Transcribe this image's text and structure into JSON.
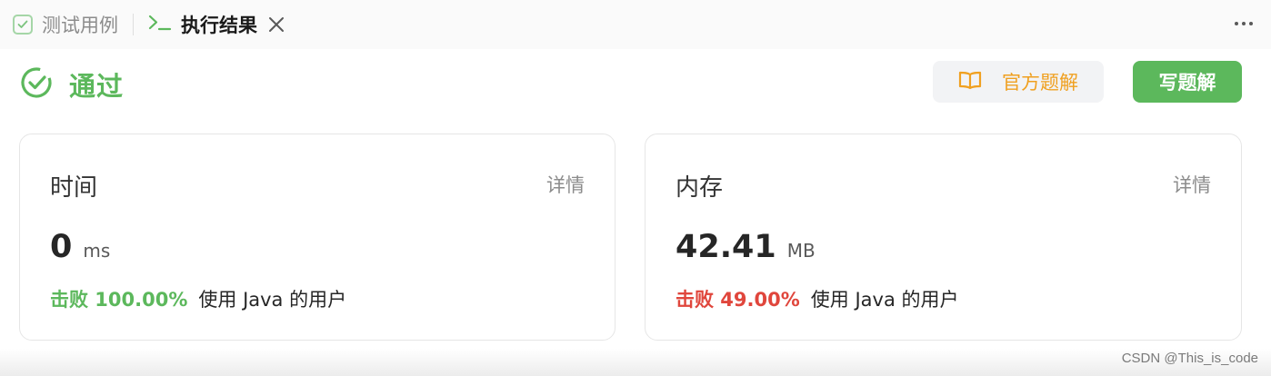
{
  "tabs": {
    "testcase_label": "测试用例",
    "result_label": "执行结果"
  },
  "status": {
    "text": "通过",
    "color": "#5cb85c"
  },
  "buttons": {
    "official_solution": "官方题解",
    "write_solution": "写题解"
  },
  "cards": {
    "time": {
      "title": "时间",
      "details": "详情",
      "value": "0",
      "unit": "ms",
      "beat_pct": "击败 100.00%",
      "beat_rest": "使用 Java 的用户",
      "beat_color": "#5cb85c"
    },
    "memory": {
      "title": "内存",
      "details": "详情",
      "value": "42.41",
      "unit": "MB",
      "beat_pct": "击败 49.00%",
      "beat_rest": "使用 Java 的用户",
      "beat_color": "#e0463c"
    }
  },
  "watermark": "CSDN @This_is_code",
  "icons": {
    "testcase": "checkbox-icon",
    "result": "terminal-icon",
    "close": "close-icon",
    "more": "more-horizontal-icon",
    "status": "check-circle-icon",
    "official": "book-icon"
  }
}
